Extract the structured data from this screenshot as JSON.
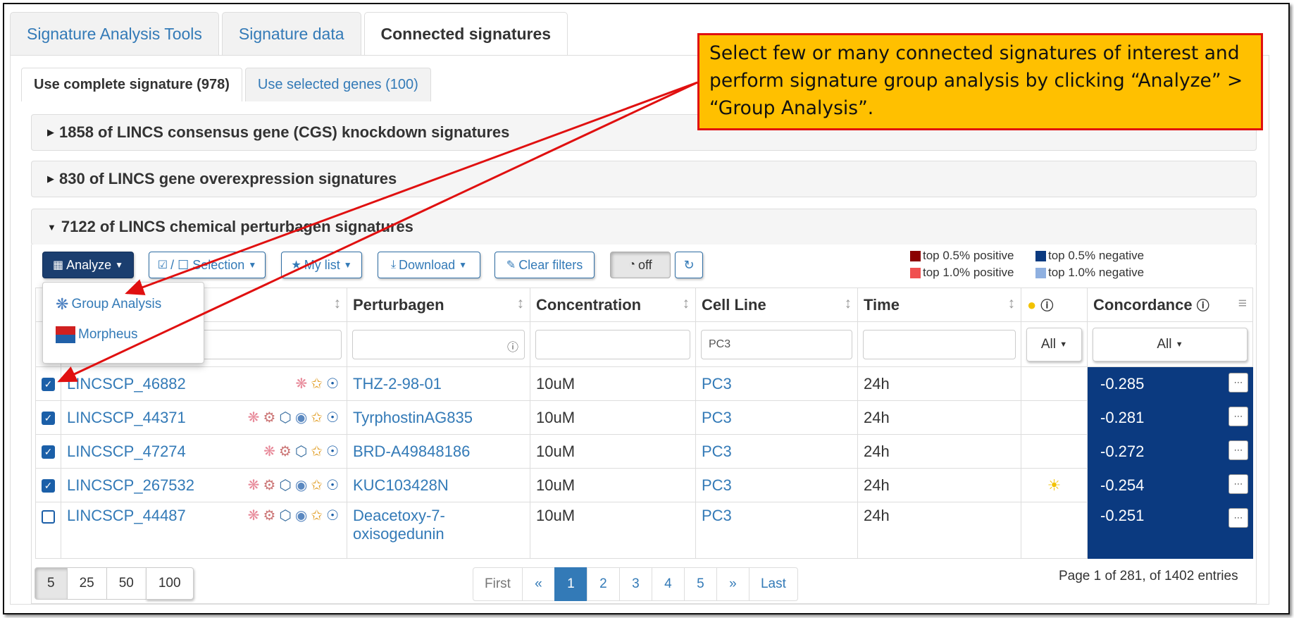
{
  "main_tabs": [
    "Signature Analysis Tools",
    "Signature data",
    "Connected signatures"
  ],
  "sub_tabs": [
    "Use complete signature (978)",
    "Use selected genes (100)"
  ],
  "accordions": [
    "1858 of LINCS consensus gene (CGS) knockdown signatures",
    "830 of LINCS gene overexpression signatures",
    "7122 of LINCS chemical perturbagen signatures"
  ],
  "toolbar": {
    "analyze": "Analyze",
    "selection": "/ ☐ Selection",
    "my_list": "My list",
    "download": "Download",
    "clear_filters": "Clear filters",
    "toggle": "off"
  },
  "legend": {
    "top05_pos": "top 0.5% positive",
    "top10_pos": "top 1.0% positive",
    "top05_neg": "top 0.5% negative",
    "top10_neg": "top 1.0% negative",
    "colors": {
      "top05_pos": "#8b0000",
      "top10_pos": "#f05050",
      "top05_neg": "#0b3a80",
      "top10_neg": "#8fb0e0"
    }
  },
  "dropdown": {
    "group_analysis": "Group Analysis",
    "morpheus": "Morpheus"
  },
  "columns": {
    "perturbagen": "Perturbagen",
    "concentration": "Concentration",
    "cell_line": "Cell Line",
    "time": "Time",
    "concordance": "Concordance"
  },
  "filters": {
    "cell_line": "PC3",
    "sun": "All",
    "concordance": "All"
  },
  "rows": [
    {
      "id": "LINCSCP_46882",
      "checked": true,
      "perturbagen": "THZ-2-98-01",
      "perturbagen2": "",
      "concentration": "10uM",
      "cell_line": "PC3",
      "time": "24h",
      "sun": false,
      "concordance": "-0.285"
    },
    {
      "id": "LINCSCP_44371",
      "checked": true,
      "perturbagen": "TyrphostinAG835",
      "perturbagen2": "",
      "concentration": "10uM",
      "cell_line": "PC3",
      "time": "24h",
      "sun": false,
      "concordance": "-0.281"
    },
    {
      "id": "LINCSCP_47274",
      "checked": true,
      "perturbagen": "BRD-A49848186",
      "perturbagen2": "",
      "concentration": "10uM",
      "cell_line": "PC3",
      "time": "24h",
      "sun": false,
      "concordance": "-0.272"
    },
    {
      "id": "LINCSCP_267532",
      "checked": true,
      "perturbagen": "KUC103428N",
      "perturbagen2": "",
      "concentration": "10uM",
      "cell_line": "PC3",
      "time": "24h",
      "sun": true,
      "concordance": "-0.254"
    },
    {
      "id": "LINCSCP_44487",
      "checked": false,
      "perturbagen": "Deacetoxy-7-",
      "perturbagen2": "oxisogedunin",
      "concentration": "10uM",
      "cell_line": "PC3",
      "time": "24h",
      "sun": false,
      "concordance": "-0.251"
    }
  ],
  "page_size": [
    "5",
    "25",
    "50",
    "100"
  ],
  "pager": [
    "First",
    "«",
    "1",
    "2",
    "3",
    "4",
    "5",
    "»",
    "Last"
  ],
  "page_info": "Page 1 of 281, of 1402 entries",
  "callout": "Select few or many connected signatures of interest and perform signature group analysis by clicking “Analyze” > “Group Analysis”."
}
